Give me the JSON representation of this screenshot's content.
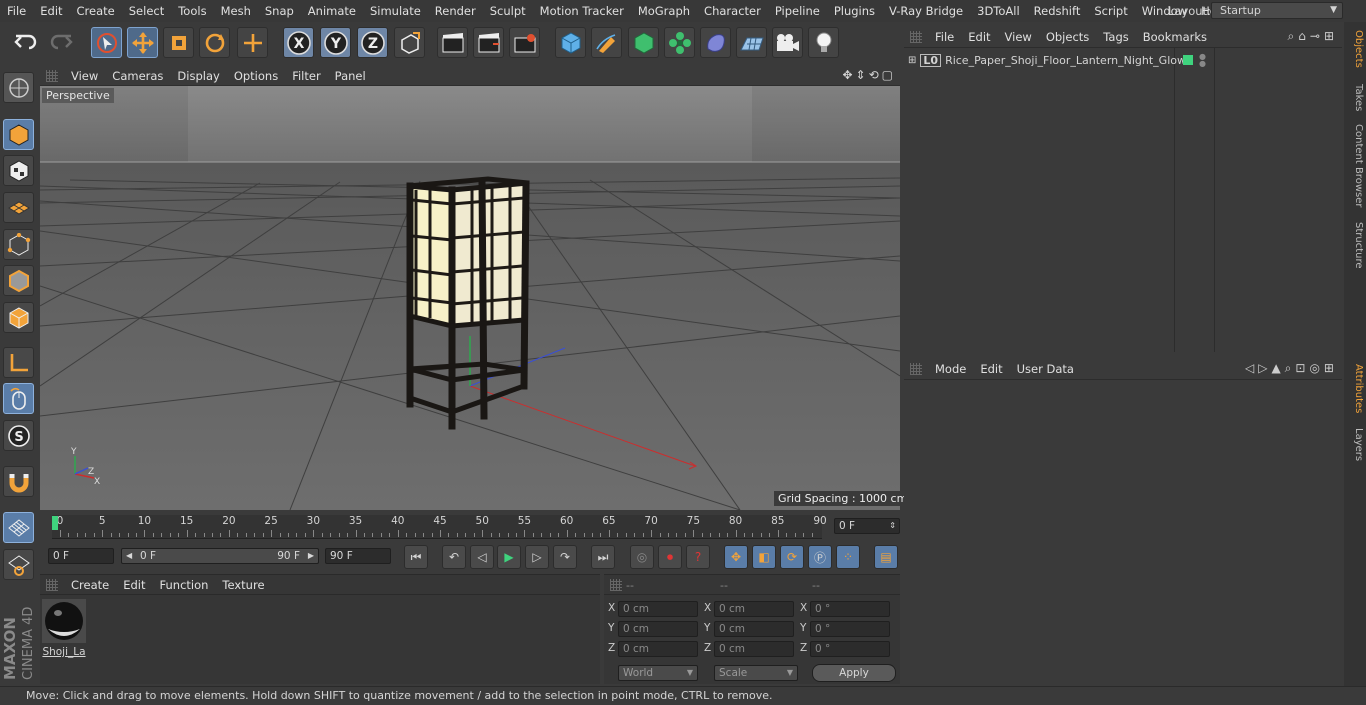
{
  "menubar": {
    "items": [
      "File",
      "Edit",
      "Create",
      "Select",
      "Tools",
      "Mesh",
      "Snap",
      "Animate",
      "Simulate",
      "Render",
      "Sculpt",
      "Motion Tracker",
      "MoGraph",
      "Character",
      "Pipeline",
      "Plugins",
      "V-Ray Bridge",
      "3DToAll",
      "Redshift",
      "Script",
      "Window",
      "Help"
    ],
    "layout_label": "Layout:",
    "layout_value": "Startup"
  },
  "toolbar": {
    "icons": [
      "undo-icon",
      "redo-icon",
      "select-icon",
      "move-icon",
      "scale-icon",
      "rotate-icon",
      "live-select-icon",
      "x-axis-icon",
      "y-axis-icon",
      "z-axis-icon",
      "coordinate-system-icon",
      "render-view-icon",
      "render-picture-viewer-icon",
      "render-settings-icon",
      "cube-icon",
      "pen-icon",
      "subdivision-icon",
      "mograph-cloner-icon",
      "deformer-icon",
      "floor-icon",
      "camera-icon",
      "light-icon"
    ],
    "axis_labels": [
      "X",
      "Y",
      "Z"
    ]
  },
  "viewport": {
    "menu": [
      "View",
      "Cameras",
      "Display",
      "Options",
      "Filter",
      "Panel"
    ],
    "label": "Perspective",
    "grid_spacing": "Grid Spacing : 1000 cm",
    "axis_y": "Y",
    "axis_z": "Z",
    "axis_x": "X"
  },
  "timeline": {
    "ticks": [
      "0",
      "5",
      "10",
      "15",
      "20",
      "25",
      "30",
      "35",
      "40",
      "45",
      "50",
      "55",
      "60",
      "65",
      "70",
      "75",
      "80",
      "85",
      "90"
    ],
    "current_frame": "0 F"
  },
  "transport": {
    "start_field": "0 F",
    "range_start": "0 F",
    "range_end": "90 F",
    "end_field": "90 F"
  },
  "materials": {
    "menu": [
      "Create",
      "Edit",
      "Function",
      "Texture"
    ],
    "items": [
      {
        "name": "Shoji_La"
      }
    ]
  },
  "coordinates": {
    "headers": [
      "--",
      "--",
      "--"
    ],
    "rows": [
      {
        "axis": "X",
        "pos": "0 cm",
        "size": "0 cm",
        "rot": "0 °"
      },
      {
        "axis": "Y",
        "pos": "0 cm",
        "size": "0 cm",
        "rot": "0 °"
      },
      {
        "axis": "Z",
        "pos": "0 cm",
        "size": "0 cm",
        "rot": "0 °"
      }
    ],
    "mode_world": "World",
    "mode_scale": "Scale",
    "apply": "Apply"
  },
  "objects": {
    "menu": [
      "File",
      "Edit",
      "View",
      "Objects",
      "Tags",
      "Bookmarks"
    ],
    "items": [
      {
        "name": "Rice_Paper_Shoji_Floor_Lantern_Night_Glow"
      }
    ]
  },
  "attributes": {
    "menu": [
      "Mode",
      "Edit",
      "User Data"
    ]
  },
  "right_tabs": [
    "Objects",
    "Takes",
    "Content Browser",
    "Structure",
    "Attributes",
    "Layers"
  ],
  "brand": {
    "maxon": "MAXON",
    "product": "CINEMA 4D"
  },
  "status": "Move: Click and drag to move elements. Hold down SHIFT to quantize movement / add to the selection in point mode, CTRL to remove.",
  "colors": {
    "accent": "#5a7da8",
    "timeline_marker": "#3fd37e",
    "lantern_glow": "#f7f1c8",
    "axis_x": "#cc2d2d",
    "axis_y": "#2fa84f",
    "axis_z": "#3a4fd6",
    "tab_active": "#f2a33a"
  }
}
